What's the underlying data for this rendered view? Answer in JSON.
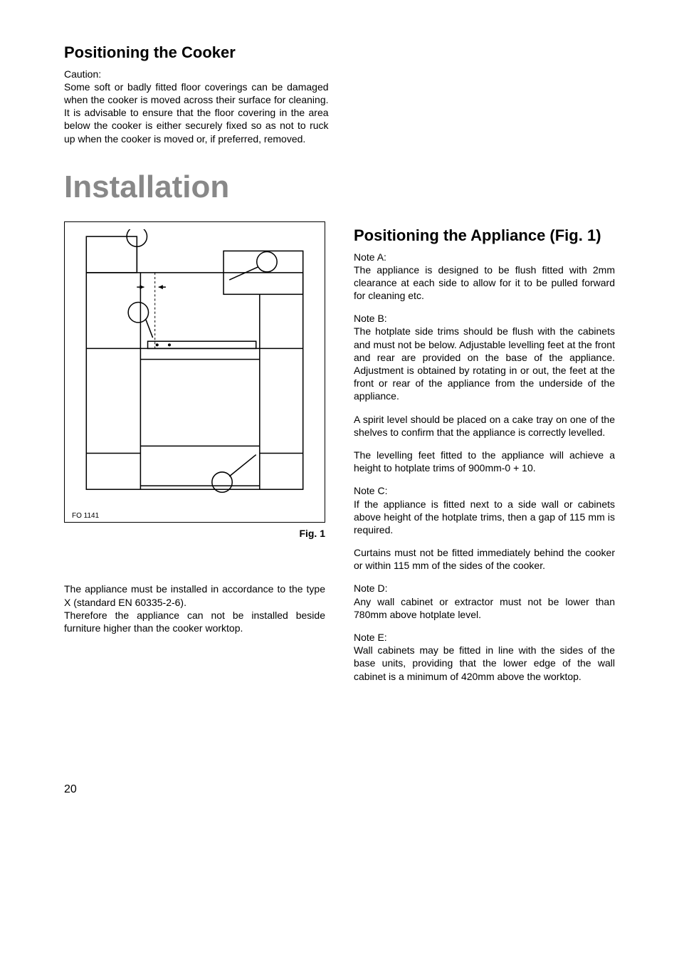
{
  "positioning_cooker": {
    "heading": "Positioning the Cooker",
    "caution_label": "Caution:",
    "caution_text": "Some soft or badly fitted floor coverings can be damaged when the cooker is moved across their surface for cleaning. It is advisable to ensure that the floor covering in the area below the cooker is either securely fixed so as not to ruck up when the cooker is moved or, if preferred, removed."
  },
  "installation": {
    "heading": "Installation",
    "figure": {
      "fo_label": "FO 1141",
      "caption": "Fig. 1"
    },
    "left_text_1": "The appliance must be installed in accordance to the type X (standard EN 60335-2-6).",
    "left_text_2": "Therefore the appliance can not be installed beside furniture higher than the cooker worktop.",
    "right": {
      "heading": "Positioning the Appliance (Fig. 1)",
      "note_a_label": "Note A:",
      "note_a": "The appliance is designed to be flush fitted with 2mm clearance at each side to allow for it to be pulled forward for cleaning etc.",
      "note_b_label": "Note B:",
      "note_b1": "The hotplate side trims should be flush with the cabinets and must not be below. Adjustable levelling feet at the front and rear are provided on the base of the appliance. Adjustment is obtained by rotating in or out, the feet at the front or rear of the appliance from the underside of the appliance.",
      "note_b2": "A spirit level should be placed on a cake tray on one of the shelves to confirm that the appliance is correctly levelled.",
      "note_b3": "The levelling feet fitted to the appliance will achieve a height to hotplate trims of 900mm-0 + 10.",
      "note_c_label": "Note C:",
      "note_c1": "If the appliance is fitted next to a side wall or cabinets above height of the hotplate trims, then a gap of 115 mm is required.",
      "note_c2": "Curtains must not be fitted immediately behind the cooker or within 115 mm of the sides of the cooker.",
      "note_d_label": "Note D:",
      "note_d": "Any wall cabinet or extractor must not be lower than 780mm above hotplate level.",
      "note_e_label": "Note E:",
      "note_e": "Wall cabinets may be fitted in line with the sides of the base units, providing that the lower edge of the wall cabinet is a minimum of 420mm above the worktop."
    }
  },
  "page_number": "20"
}
